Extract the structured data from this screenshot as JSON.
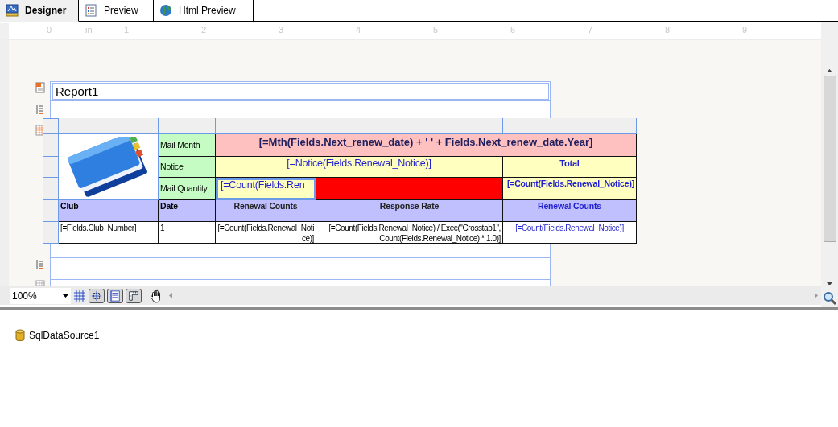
{
  "tabs": [
    {
      "label": "Designer",
      "selected": true,
      "kind": "designer"
    },
    {
      "label": "Preview",
      "selected": false,
      "kind": "preview"
    },
    {
      "label": "Html Preview",
      "selected": false,
      "kind": "html"
    }
  ],
  "ruler": [
    "0",
    "in",
    "1",
    "2",
    "3",
    "4",
    "5",
    "6",
    "7",
    "8",
    "9"
  ],
  "report": {
    "title": "Report1",
    "crosstab": {
      "row_labels": [
        "Mail Month",
        "Notice",
        "Mail Quantity"
      ],
      "month_expr": "[=Mth(Fields.Next_renew_date) + ' ' + Fields.Next_renew_date.Year]",
      "notice_expr": "[=Notice(Fields.Renewal_Notice)]",
      "total_label": "Total",
      "count_expr": "[=Count(Fields.Ren",
      "total_count_expr": "[=Count(Fields.Renewal_Notice)]",
      "columns": [
        "Club",
        "Date",
        "Renewal Counts",
        "Response Rate",
        "Renewal Counts"
      ],
      "row": [
        "[=Fields.Club_Number]",
        "1",
        "[=Count(Fields.Renewal_Notice)]",
        "[=Count(Fields.Renewal_Notice) / Exec(\"Crosstab1\", Count(Fields.Renewal_Notice) * 1.0)]",
        "[=Count(Fields.Renewal_Notice)]"
      ]
    }
  },
  "toolbar": {
    "zoom": "100%",
    "view_toggles": [
      {
        "on": true
      },
      {
        "on": true
      },
      {
        "on": true
      }
    ]
  },
  "data_sources": [
    "SqlDataSource1"
  ]
}
